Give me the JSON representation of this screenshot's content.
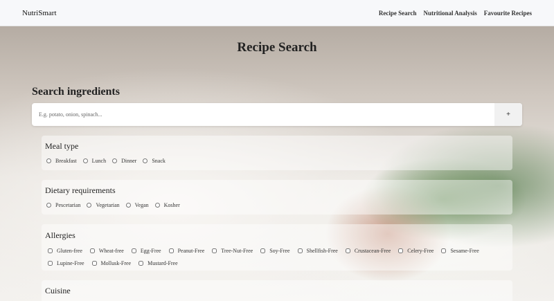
{
  "navbar": {
    "brand": "NutriSmart",
    "links": [
      "Recipe Search",
      "Nutritional Analysis",
      "Favourite Recipes"
    ]
  },
  "page": {
    "title": "Recipe Search"
  },
  "search": {
    "heading": "Search ingredients",
    "placeholder": "E.g. potato, onion, spinach...",
    "add_label": "+"
  },
  "meal_type": {
    "title": "Meal type",
    "options": [
      "Breakfast",
      "Lunch",
      "Dinner",
      "Snack"
    ]
  },
  "dietary": {
    "title": "Dietary requirements",
    "options": [
      "Pescetarian",
      "Vegetarian",
      "Vegan",
      "Kosher"
    ]
  },
  "allergies": {
    "title": "Allergies",
    "options": [
      "Gluten-free",
      "Wheat-free",
      "Egg-Free",
      "Peanut-Free",
      "Tree-Nut-Free",
      "Soy-Free",
      "Shellfish-Free",
      "Crustacean-Free",
      "Celery-Free",
      "Sesame-Free",
      "Lupine-Free",
      "Mollusk-Free",
      "Mustard-Free"
    ]
  },
  "cuisine": {
    "title": "Cuisine"
  }
}
